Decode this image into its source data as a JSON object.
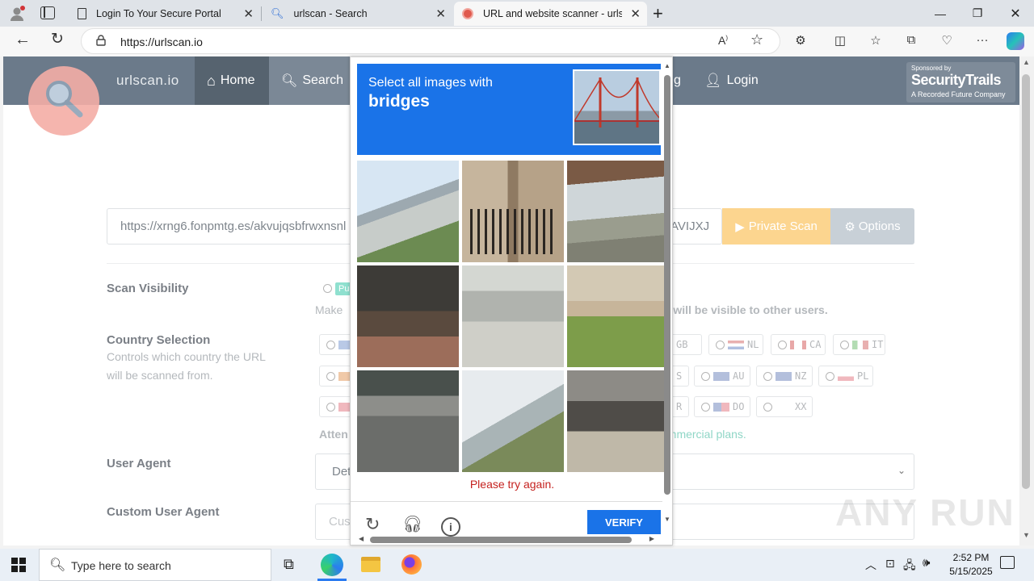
{
  "browser": {
    "tabs": [
      {
        "title": "Login To Your Secure Portal"
      },
      {
        "title": "urlscan - Search"
      },
      {
        "title": "URL and website scanner - urlsca"
      }
    ],
    "url": "https://urlscan.io"
  },
  "site": {
    "brand": "urlscan.io",
    "nav": [
      {
        "label": "Home"
      },
      {
        "label": "Search"
      },
      {
        "label": "Login"
      }
    ],
    "nav_partial": "g",
    "sponsor_small": "Sponsored by",
    "sponsor_name": "SecurityTrails",
    "sponsor_sub": "A Recorded Future Company",
    "url_input": "https://xrng6.fonpmtg.es/akvujqsbfrwxnsnl",
    "url_input_tail": "AVIJXJ",
    "private_scan": "Private Scan",
    "options": "Options",
    "scan_visibility": "Scan Visibility",
    "vis_prefix": "Make",
    "vis_text": "r will be visible to other users.",
    "vis_badge": "Pu",
    "country_selection": "Country Selection",
    "country_help_1": "Controls which country the URL",
    "country_help_2": "will be scanned from.",
    "countries_row1": [
      "GB",
      "NL",
      "CA",
      "IT"
    ],
    "countries_row2": [
      "S",
      "AU",
      "NZ",
      "PL"
    ],
    "countries_row3": [
      "R",
      "DO",
      "XX"
    ],
    "atten_left": "Atten",
    "atten_right": "ommercial plans.",
    "user_agent": "User Agent",
    "ua_value": "Det",
    "custom_user_agent": "Custom User Agent",
    "custom_ua_placeholder": "Cus"
  },
  "captcha": {
    "instruction": "Select all images with",
    "target": "bridges",
    "error": "Please try again.",
    "verify": "VERIFY"
  },
  "watermark": "ANY RUN",
  "taskbar": {
    "search_placeholder": "Type here to search",
    "time": "2:52 PM",
    "date": "5/15/2025"
  },
  "colors": {
    "nav": "#6b7a8a",
    "captcha_blue": "#1a73e8",
    "private_scan": "#fcd58f",
    "options": "#c8d0d7",
    "error": "#c5221f"
  }
}
